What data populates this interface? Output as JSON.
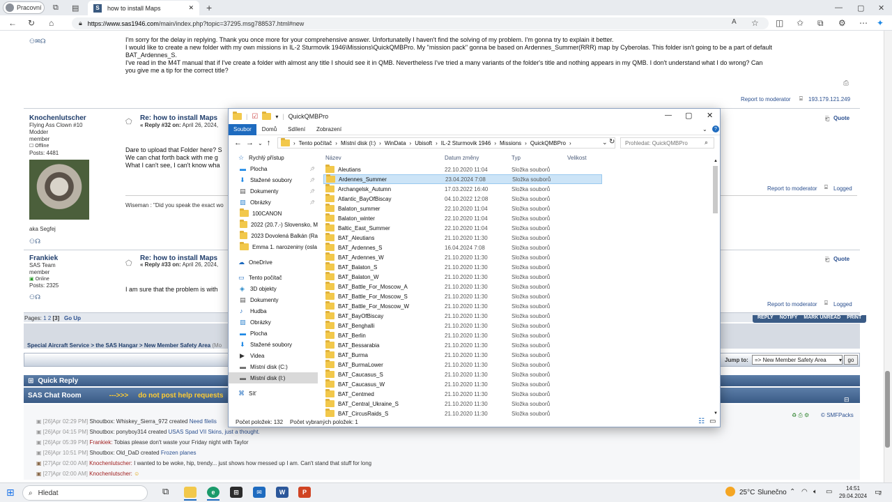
{
  "browser": {
    "profile_label": "Pracovní",
    "tab_title": "how to install Maps",
    "url_host": "https://www.sas1946.com",
    "url_path": "/main/index.php?topic=37295.msg788537.html#new"
  },
  "post_top": {
    "lines": [
      "I'm sorry for the delay in replying. Thank you once more for your comprehensive answer. Unfortunatelly I haven't find the solving of my problem. I'm gonna try to explain it better.",
      "I would like to create a new folder with my own missions in IL-2 Sturmovik 1946\\Missions\\QuickQMBPro. My \"mission pack\" gonna be based on Ardennes_Summer(RRR) map by Cyberolas. This folder isn't going to be a part of default",
      "BAT_Ardennes_S.",
      "I've read in the M4T manual that if I've create a folder with almost any title I should see it in QMB. Nevertheless I've tried a many variants of the folder's title and nothing appears in my QMB. I don't understand what I do wrong? Can",
      "you give me a tip for the correct title?"
    ],
    "report": "Report to moderator",
    "ip": "193.179.121.249"
  },
  "post32": {
    "author": "Knochenlutscher",
    "rank": "Flying Ass Clown #10",
    "group": "Modder",
    "member": "member",
    "status": "Offline",
    "posts": "Posts: 4481",
    "tagline": "aka Segfej",
    "title": "Re: how to install Maps",
    "meta_prefix": "« Reply #32 on:",
    "meta_date": "April 26, 2024,",
    "quote": "Quote",
    "lines": [
      "Dare to upload that Folder here? S",
      "We can chat forth back with me g",
      "What I can't see, I can't know wha"
    ],
    "signature": "Wiseman : \"Did you speak the exact wo",
    "report": "Report to moderator",
    "logged": "Logged"
  },
  "post33": {
    "author": "Frankiek",
    "rank": "SAS Team",
    "member": "member",
    "status": "Online",
    "posts": "Posts: 2325",
    "title": "Re: how to install Maps",
    "meta_prefix": "« Reply #33 on:",
    "meta_date": "April 26, 2024,",
    "quote": "Quote",
    "text": "I am sure that the problem is with",
    "report": "Report to moderator",
    "logged": "Logged"
  },
  "pages": {
    "label": "Pages:",
    "p1": "1",
    "p2": "2",
    "p3": "[3]",
    "goup": "Go Up"
  },
  "actions": [
    "REPLY",
    "NOTIFY",
    "MARK UNREAD",
    "PRINT"
  ],
  "linktree": [
    "Special Aircraft Service",
    "the SAS Hangar",
    "New Member Safety Area",
    "(Mo"
  ],
  "jump": {
    "label": "Jump to:",
    "value": "=> New Member Safety Area",
    "go": "go"
  },
  "quick_reply": "Quick Reply",
  "chat": {
    "title": "SAS Chat Room",
    "arrow": "--->>>",
    "notice": "do not post help requests",
    "credit": "© SMFPacks"
  },
  "shoutbox": [
    {
      "ts": "[26]Apr 02:29 PM]",
      "who": "Shoutbox:",
      "a": "Whiskey_Sierra_972 created",
      "link": "Need filelis",
      "b": ""
    },
    {
      "ts": "[26]Apr 04:15 PM]",
      "who": "Shoutbox:",
      "a": "ponyboy314 created",
      "link": "USAS Spad VII Skins, just a thought.",
      "b": ""
    },
    {
      "ts": "[26]Apr 05:39 PM]",
      "who": "Frankiek:",
      "a": "Tobias please don't waste your Friday night with Taylor",
      "link": "",
      "b": ""
    },
    {
      "ts": "[26]Apr 10:51 PM]",
      "who": "Shoutbox:",
      "a": "Old_DaD created",
      "link": "Frozen planes",
      "b": ""
    },
    {
      "ts": "[27]Apr 02:00 AM]",
      "who": "Knochenlutscher:",
      "a": "I wanted to be woke, hip, trendy... just shows how messed up I am. Can't stand that stuff for long",
      "link": "",
      "b": ""
    },
    {
      "ts": "[27]Apr 02:00 AM]",
      "who": "Knochenlutscher:",
      "a": "",
      "link": "",
      "b": ""
    }
  ],
  "explorer": {
    "title": "QuickQMBPro",
    "ribbon": [
      "Soubor",
      "Domů",
      "Sdílení",
      "Zobrazení"
    ],
    "path": [
      "Tento počítač",
      "Místní disk (I:)",
      "WinData",
      "Ubisoft",
      "IL-2 Sturmovik 1946",
      "Missions",
      "QuickQMBPro"
    ],
    "search_placeholder": "Prohledat: QuickQMBPro",
    "nav": [
      {
        "label": "Rychlý přístup",
        "kind": "star",
        "top": true
      },
      {
        "label": "Plocha",
        "kind": "blue"
      },
      {
        "label": "Stažené soubory",
        "kind": "down"
      },
      {
        "label": "Dokumenty",
        "kind": "doc"
      },
      {
        "label": "Obrázky",
        "kind": "pic"
      },
      {
        "label": "100CANON",
        "kind": "folder"
      },
      {
        "label": "2022 (20.7.-) Slovensko,  M",
        "kind": "folder"
      },
      {
        "label": "2023 Dovolená Balkán (Ra",
        "kind": "folder"
      },
      {
        "label": "Emma 1. narozeniny (osla",
        "kind": "folder"
      },
      {
        "label": "",
        "kind": "gap"
      },
      {
        "label": "OneDrive",
        "kind": "cloud",
        "top": true
      },
      {
        "label": "",
        "kind": "gap"
      },
      {
        "label": "Tento počítač",
        "kind": "pc",
        "top": true
      },
      {
        "label": "3D objekty",
        "kind": "cube"
      },
      {
        "label": "Dokumenty",
        "kind": "doc"
      },
      {
        "label": "Hudba",
        "kind": "music"
      },
      {
        "label": "Obrázky",
        "kind": "pic"
      },
      {
        "label": "Plocha",
        "kind": "blue"
      },
      {
        "label": "Stažené soubory",
        "kind": "down"
      },
      {
        "label": "Videa",
        "kind": "video"
      },
      {
        "label": "Místní disk (C:)",
        "kind": "disk"
      },
      {
        "label": "Místní disk (I:)",
        "kind": "disk",
        "sel": true
      },
      {
        "label": "",
        "kind": "gap"
      },
      {
        "label": "Síť",
        "kind": "net",
        "top": true
      }
    ],
    "columns": [
      "Název",
      "Datum změny",
      "Typ",
      "Velikost"
    ],
    "files": [
      [
        "Aleutians",
        "22.10.2020 11:04",
        "Složka souborů"
      ],
      [
        "Ardennes_Summer",
        "23.04.2024 7:08",
        "Složka souborů"
      ],
      [
        "Archangelsk_Autumn",
        "17.03.2022 16:40",
        "Složka souborů"
      ],
      [
        "Atlantic_BayOfBiscay",
        "04.10.2022 12:08",
        "Složka souborů"
      ],
      [
        "Balaton_summer",
        "22.10.2020 11:04",
        "Složka souborů"
      ],
      [
        "Balaton_winter",
        "22.10.2020 11:04",
        "Složka souborů"
      ],
      [
        "Baltic_East_Summer",
        "22.10.2020 11:04",
        "Složka souborů"
      ],
      [
        "BAT_Aleutians",
        "21.10.2020 11:30",
        "Složka souborů"
      ],
      [
        "BAT_Ardennes_S",
        "16.04.2024 7:08",
        "Složka souborů"
      ],
      [
        "BAT_Ardennes_W",
        "21.10.2020 11:30",
        "Složka souborů"
      ],
      [
        "BAT_Balaton_S",
        "21.10.2020 11:30",
        "Složka souborů"
      ],
      [
        "BAT_Balaton_W",
        "21.10.2020 11:30",
        "Složka souborů"
      ],
      [
        "BAT_Battle_For_Moscow_A",
        "21.10.2020 11:30",
        "Složka souborů"
      ],
      [
        "BAT_Battle_For_Moscow_S",
        "21.10.2020 11:30",
        "Složka souborů"
      ],
      [
        "BAT_Battle_For_Moscow_W",
        "21.10.2020 11:30",
        "Složka souborů"
      ],
      [
        "BAT_BayOfBiscay",
        "21.10.2020 11:30",
        "Složka souborů"
      ],
      [
        "BAT_Benghalli",
        "21.10.2020 11:30",
        "Složka souborů"
      ],
      [
        "BAT_Berlin",
        "21.10.2020 11:30",
        "Složka souborů"
      ],
      [
        "BAT_Bessarabia",
        "21.10.2020 11:30",
        "Složka souborů"
      ],
      [
        "BAT_Burma",
        "21.10.2020 11:30",
        "Složka souborů"
      ],
      [
        "BAT_BurmaLower",
        "21.10.2020 11:30",
        "Složka souborů"
      ],
      [
        "BAT_Caucasus_S",
        "21.10.2020 11:30",
        "Složka souborů"
      ],
      [
        "BAT_Caucasus_W",
        "21.10.2020 11:30",
        "Složka souborů"
      ],
      [
        "BAT_Centmed",
        "21.10.2020 11:30",
        "Složka souborů"
      ],
      [
        "BAT_Central_Ukraine_S",
        "21.10.2020 11:30",
        "Složka souborů"
      ],
      [
        "BAT_CircusRaids_S",
        "21.10.2020 11:30",
        "Složka souborů"
      ]
    ],
    "selected_index": 1,
    "status_count": "Počet položek: 132",
    "status_selected": "Počet vybraných položek: 1"
  },
  "taskbar": {
    "search": "Hledat",
    "weather_temp": "25°C",
    "weather_text": "Slunečno",
    "time": "14:51",
    "date": "29.04.2024",
    "notif": "2"
  },
  "colors": {
    "folder": "#f2c84b",
    "selection": "#cce4f7",
    "forum_blue": "#3a5b86",
    "explorer_accent": "#1e6bbf"
  }
}
